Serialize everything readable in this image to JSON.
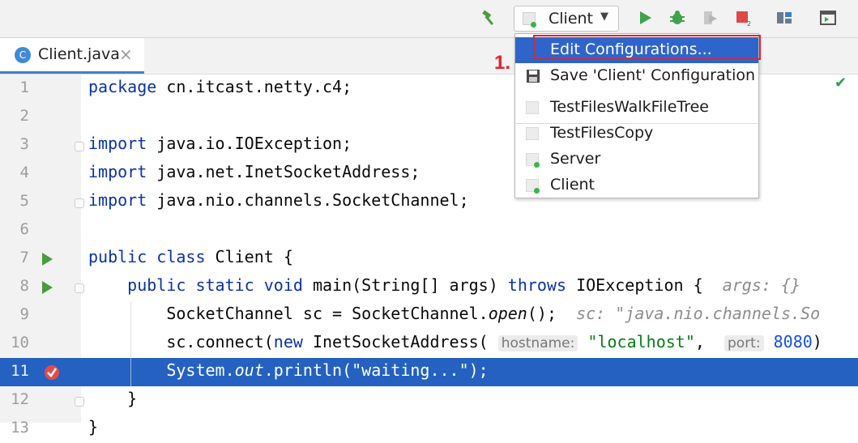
{
  "toolbar": {
    "run_config": {
      "label": "Client"
    },
    "icons": [
      "build-hammer-icon",
      "run-icon",
      "debug-icon",
      "coverage-icon",
      "stop-icon",
      "project-structure-icon",
      "terminal-icon"
    ]
  },
  "tabs": [
    {
      "label": "Client.java",
      "icon": "java-class-icon",
      "close_symbol": "×"
    }
  ],
  "editor": {
    "lines": [
      {
        "n": "1",
        "code": "package cn.itcast.netty.c4;"
      },
      {
        "n": "2",
        "code": ""
      },
      {
        "n": "3",
        "code": "import java.io.IOException;"
      },
      {
        "n": "4",
        "code": "import java.net.InetSocketAddress;"
      },
      {
        "n": "5",
        "code": "import java.nio.channels.SocketChannel;"
      },
      {
        "n": "6",
        "code": ""
      },
      {
        "n": "7",
        "code": "public class Client {"
      },
      {
        "n": "8",
        "code": "    public static void main(String[] args) throws IOException {",
        "hint": "args: {}"
      },
      {
        "n": "9",
        "code": "        SocketChannel sc = SocketChannel.open();",
        "hint": "sc: \"java.nio.channels.So"
      },
      {
        "n": "10",
        "code": "        sc.connect(new InetSocketAddress( hostname: \"localhost\",  port: 8080)"
      },
      {
        "n": "11",
        "code": "        System.out.println(\"waiting...\");",
        "highlighted": true,
        "breakpoint": true
      },
      {
        "n": "12",
        "code": "    }"
      },
      {
        "n": "13",
        "code": "}"
      }
    ]
  },
  "menu": {
    "items": [
      {
        "label": "Edit Configurations...",
        "selected": true
      },
      {
        "label": "Save 'Client' Configuration"
      },
      {
        "label": "TestFilesWalkFileTree"
      },
      {
        "label": "TestFilesCopy"
      },
      {
        "label": "Server"
      },
      {
        "label": "Client"
      }
    ]
  },
  "annotation": {
    "step": "1."
  },
  "colors": {
    "selection": "#2461c0",
    "menu_selected": "#2f65ca",
    "callout": "#e3232e",
    "run_green": "#4a9c3c"
  }
}
